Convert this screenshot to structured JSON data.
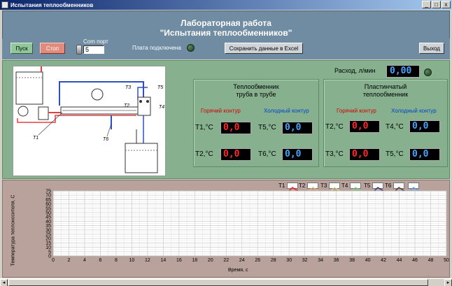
{
  "window": {
    "title": "Испытания теплообменников",
    "min": "_",
    "max": "□",
    "close": "x"
  },
  "header": {
    "line1": "Лабораторная работа",
    "line2": "\"Испытания теплообменников\""
  },
  "toolbar": {
    "start_label": "Пуск",
    "stop_label": "Стоп",
    "com_label": "Com порт",
    "com_value": "5",
    "board_label": "Плата подключена",
    "save_label": "Сохранить данные в Excel",
    "exit_label": "Выход"
  },
  "flow": {
    "label": "Расход, л/мин",
    "value": "0,00"
  },
  "hx_tube": {
    "title1": "Теплообменник",
    "title2": "труба в трубе",
    "hot_label": "Горячий контур",
    "cold_label": "Холодный контур",
    "params": [
      {
        "label": "T1,°C",
        "value": "0,0"
      },
      {
        "label": "T5,°C",
        "value": "0,0"
      },
      {
        "label": "T2,°C",
        "value": "0,0"
      },
      {
        "label": "T6,°C",
        "value": "0,0"
      }
    ]
  },
  "hx_plate": {
    "title1": "Пластинчатый",
    "title2": "теплообменник",
    "hot_label": "Горячий контур",
    "cold_label": "Холодный контур",
    "params": [
      {
        "label": "T2,°C",
        "value": "0,0"
      },
      {
        "label": "T4,°C",
        "value": "0,0"
      },
      {
        "label": "T3,°C",
        "value": "0,0"
      },
      {
        "label": "T5,°C",
        "value": "0,0"
      }
    ]
  },
  "diagram_labels": {
    "t1": "T1",
    "t2": "T2",
    "t3": "T3",
    "t4": "T4",
    "t5": "T5",
    "t6": "T6"
  },
  "legend": [
    {
      "name": "T1",
      "color": "#ff0000"
    },
    {
      "name": "T2",
      "color": "#ffb070"
    },
    {
      "name": "T3",
      "color": "#e8e070"
    },
    {
      "name": "T4",
      "color": "#70e070"
    },
    {
      "name": "T5",
      "color": "#202080"
    },
    {
      "name": "T6",
      "color": "#303030"
    },
    {
      "name": "",
      "color": "#4aa3ff"
    }
  ],
  "chart_data": {
    "type": "line",
    "xlabel": "Время, с",
    "ylabel": "Температура теплоносителя, С",
    "xlim": [
      0,
      50
    ],
    "ylim": [
      0,
      75
    ],
    "xticks": [
      0,
      2,
      4,
      6,
      8,
      10,
      12,
      14,
      16,
      18,
      20,
      22,
      24,
      26,
      28,
      30,
      32,
      34,
      36,
      38,
      40,
      42,
      44,
      46,
      48,
      50
    ],
    "yticks": [
      0,
      5,
      10,
      15,
      20,
      25,
      30,
      35,
      40,
      45,
      50,
      55,
      60,
      65,
      70,
      75
    ],
    "grid": true,
    "series": []
  }
}
